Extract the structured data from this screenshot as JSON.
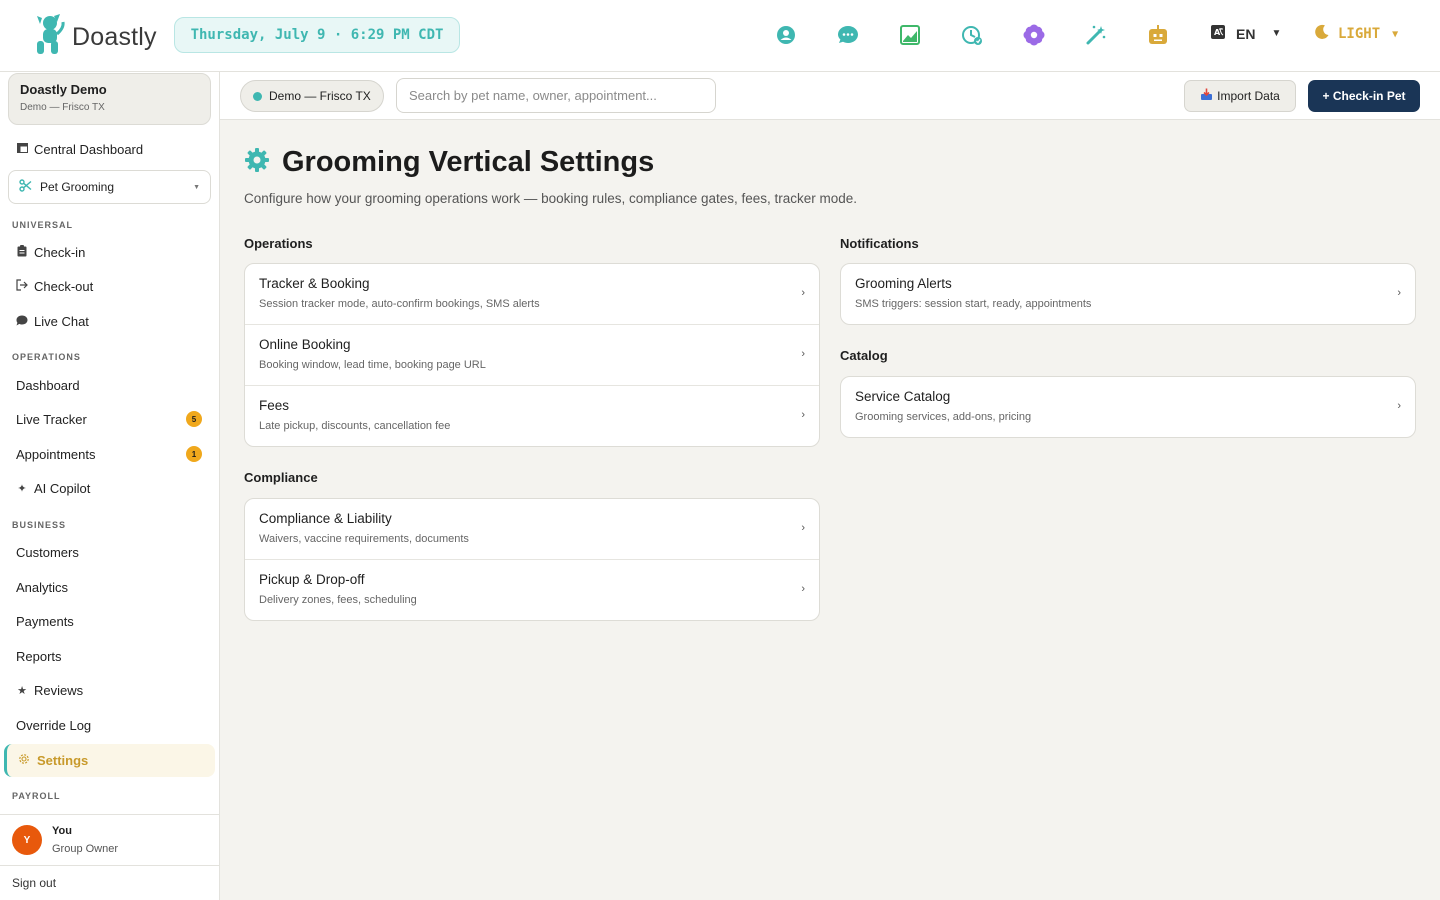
{
  "brand": {
    "name": "Doastly"
  },
  "topbar": {
    "datetime": "Thursday, July 9 · 6:29 PM CDT",
    "icons": [
      {
        "name": "support-icon",
        "color": "#3fb7b1"
      },
      {
        "name": "chat-icon",
        "color": "#3fb7b1"
      },
      {
        "name": "analytics-icon",
        "color": "#3fb86a"
      },
      {
        "name": "history-clock-icon",
        "color": "#3fb7b1"
      },
      {
        "name": "grooming-flower-icon",
        "color": "#9b6ae6"
      },
      {
        "name": "magic-wand-icon",
        "color": "#3fb7b1"
      },
      {
        "name": "robot-icon",
        "color": "#d9a93a"
      }
    ],
    "language": "EN",
    "theme": "LIGHT"
  },
  "sidebar": {
    "org_name": "Doastly Demo",
    "org_location": "Demo — Frisco TX",
    "central_dashboard": "Central Dashboard",
    "vertical": "Pet Grooming",
    "sections": {
      "universal": "UNIVERSAL",
      "operations": "OPERATIONS",
      "business": "BUSINESS",
      "payroll": "PAYROLL"
    },
    "universal_items": [
      "Check-in",
      "Check-out",
      "Live Chat"
    ],
    "operations_items": [
      "Dashboard",
      "Live Tracker",
      "Appointments",
      "AI Copilot"
    ],
    "business_items": [
      "Customers",
      "Analytics",
      "Payments",
      "Reports",
      "Reviews",
      "Override Log",
      "Settings"
    ],
    "badges": {
      "live_tracker": "5",
      "appointments": "1"
    },
    "user": {
      "initial": "Y",
      "name": "You",
      "role": "Group Owner"
    },
    "sign_out": "Sign out"
  },
  "subheader": {
    "location": "Demo — Frisco TX",
    "search_placeholder": "Search by pet name, owner, appointment...",
    "import_label": "Import Data",
    "checkin_label": "+ Check-in Pet"
  },
  "main": {
    "title": "Grooming Vertical Settings",
    "description": "Configure how your grooming operations work — booking rules, compliance gates, fees, tracker mode.",
    "groups": {
      "operations": {
        "title": "Operations",
        "cards": [
          {
            "title": "Tracker & Booking",
            "desc": "Session tracker mode, auto-confirm bookings, SMS alerts"
          },
          {
            "title": "Online Booking",
            "desc": "Booking window, lead time, booking page URL"
          },
          {
            "title": "Fees",
            "desc": "Late pickup, discounts, cancellation fee"
          }
        ]
      },
      "compliance": {
        "title": "Compliance",
        "cards": [
          {
            "title": "Compliance & Liability",
            "desc": "Waivers, vaccine requirements, documents"
          },
          {
            "title": "Pickup & Drop-off",
            "desc": "Delivery zones, fees, scheduling"
          }
        ]
      },
      "notifications": {
        "title": "Notifications",
        "cards": [
          {
            "title": "Grooming Alerts",
            "desc": "SMS triggers: session start, ready, appointments"
          }
        ]
      },
      "catalog": {
        "title": "Catalog",
        "cards": [
          {
            "title": "Service Catalog",
            "desc": "Grooming services, add-ons, pricing"
          }
        ]
      }
    }
  },
  "colors": {
    "accent": "#3fb7b1",
    "primary_button": "#1a3556",
    "settings_active": "#c89a2b",
    "badge": "#f0a81c"
  }
}
